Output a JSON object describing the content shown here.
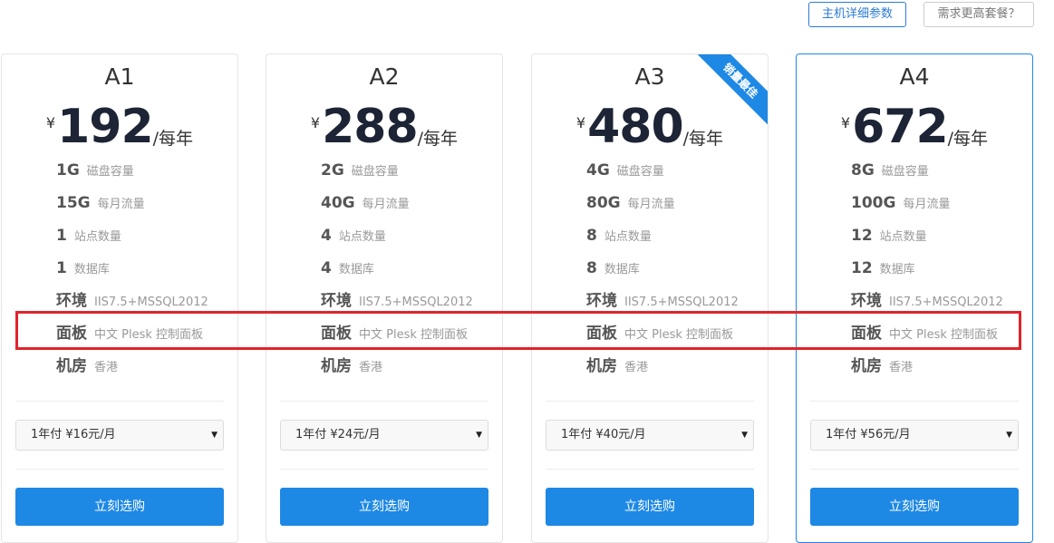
{
  "top_buttons": {
    "detail_label": "主机详细参数",
    "more_label": "需求更高套餐？"
  },
  "colors": {
    "accent": "#1e88e5",
    "highlight_box": "#e0242c"
  },
  "plans": [
    {
      "name": "A1",
      "currency": "¥",
      "price": "192",
      "period": "/每年",
      "specs": [
        {
          "value": "1G",
          "label": "磁盘容量"
        },
        {
          "value": "15G",
          "label": "每月流量"
        },
        {
          "value": "1",
          "label": "站点数量"
        },
        {
          "value": "1",
          "label": "数据库"
        },
        {
          "value": "环境",
          "label": "IIS7.5+MSSQL2012"
        },
        {
          "value": "面板",
          "label": "中文 Plesk 控制面板"
        },
        {
          "value": "机房",
          "label": "香港"
        }
      ],
      "billing_option": "1年付 ¥16元/月",
      "buy_label": "立刻选购"
    },
    {
      "name": "A2",
      "currency": "¥",
      "price": "288",
      "period": "/每年",
      "specs": [
        {
          "value": "2G",
          "label": "磁盘容量"
        },
        {
          "value": "40G",
          "label": "每月流量"
        },
        {
          "value": "4",
          "label": "站点数量"
        },
        {
          "value": "4",
          "label": "数据库"
        },
        {
          "value": "环境",
          "label": "IIS7.5+MSSQL2012"
        },
        {
          "value": "面板",
          "label": "中文 Plesk 控制面板"
        },
        {
          "value": "机房",
          "label": "香港"
        }
      ],
      "billing_option": "1年付 ¥24元/月",
      "buy_label": "立刻选购"
    },
    {
      "name": "A3",
      "currency": "¥",
      "price": "480",
      "period": "/每年",
      "ribbon": "销量最佳",
      "specs": [
        {
          "value": "4G",
          "label": "磁盘容量"
        },
        {
          "value": "80G",
          "label": "每月流量"
        },
        {
          "value": "8",
          "label": "站点数量"
        },
        {
          "value": "8",
          "label": "数据库"
        },
        {
          "value": "环境",
          "label": "IIS7.5+MSSQL2012"
        },
        {
          "value": "面板",
          "label": "中文 Plesk 控制面板"
        },
        {
          "value": "机房",
          "label": "香港"
        }
      ],
      "billing_option": "1年付 ¥40元/月",
      "buy_label": "立刻选购"
    },
    {
      "name": "A4",
      "currency": "¥",
      "price": "672",
      "period": "/每年",
      "specs": [
        {
          "value": "8G",
          "label": "磁盘容量"
        },
        {
          "value": "100G",
          "label": "每月流量"
        },
        {
          "value": "12",
          "label": "站点数量"
        },
        {
          "value": "12",
          "label": "数据库"
        },
        {
          "value": "环境",
          "label": "IIS7.5+MSSQL2012"
        },
        {
          "value": "面板",
          "label": "中文 Plesk 控制面板"
        },
        {
          "value": "机房",
          "label": "香港"
        }
      ],
      "billing_option": "1年付 ¥56元/月",
      "buy_label": "立刻选购"
    }
  ]
}
